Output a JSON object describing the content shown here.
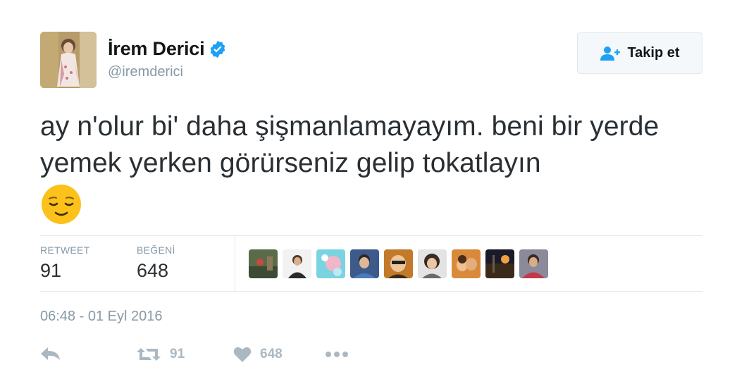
{
  "user": {
    "display_name": "İrem Derici",
    "handle": "@iremderici",
    "verified": true,
    "avatar_icon": "profile-photo"
  },
  "follow_button": {
    "label": "Takip et",
    "icon": "add-user-icon"
  },
  "tweet": {
    "text": "ay n'olur bi' daha şişmanlamayayım. beni bir yerde yemek yerken görürseniz gelip tokatlayın",
    "emoji": "relieved-face"
  },
  "stats": {
    "retweet_label": "RETWEET",
    "retweet_count": "91",
    "like_label": "BEĞENİ",
    "like_count": "648",
    "liker_avatars_count": 9
  },
  "timestamp": "06:48 - 01 Eyl 2016",
  "actions": {
    "reply_icon": "reply-icon",
    "retweet_icon": "retweet-icon",
    "retweet_count": "91",
    "like_icon": "heart-icon",
    "like_count": "648",
    "more_icon": "more-icon"
  },
  "colors": {
    "name": "#14171a",
    "muted": "#8899a6",
    "verified_blue": "#1da1f2",
    "action_gray": "#aab8c2",
    "border": "#e1e8ed"
  }
}
